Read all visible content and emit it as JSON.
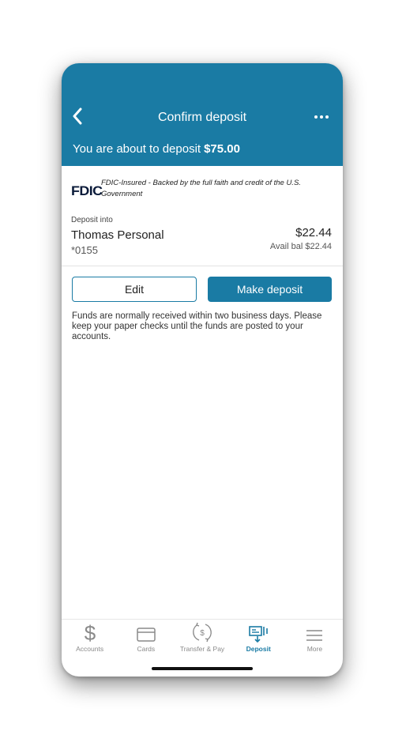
{
  "header": {
    "title": "Confirm deposit",
    "subtitle_prefix": "You are about to deposit",
    "amount": "$75.00",
    "color": "#1a7ba4"
  },
  "fdic": {
    "logo_text": "FDIC",
    "text": "FDIC-Insured - Backed by the full faith and credit of the U.S. Government"
  },
  "account": {
    "label": "Deposit into",
    "name": "Thomas Personal",
    "number": "*0155",
    "balance": "$22.44",
    "available": "Avail bal $22.44"
  },
  "buttons": {
    "edit": "Edit",
    "make_deposit": "Make deposit"
  },
  "notice": "Funds are normally received within two business days. Please keep your paper checks until the funds are posted to your accounts.",
  "tabs": [
    {
      "label": "Accounts",
      "icon": "dollar-icon",
      "active": false
    },
    {
      "label": "Cards",
      "icon": "card-icon",
      "active": false
    },
    {
      "label": "Transfer & Pay",
      "icon": "transfer-icon",
      "active": false
    },
    {
      "label": "Deposit",
      "icon": "deposit-check-icon",
      "active": true
    },
    {
      "label": "More",
      "icon": "menu-icon",
      "active": false
    }
  ]
}
